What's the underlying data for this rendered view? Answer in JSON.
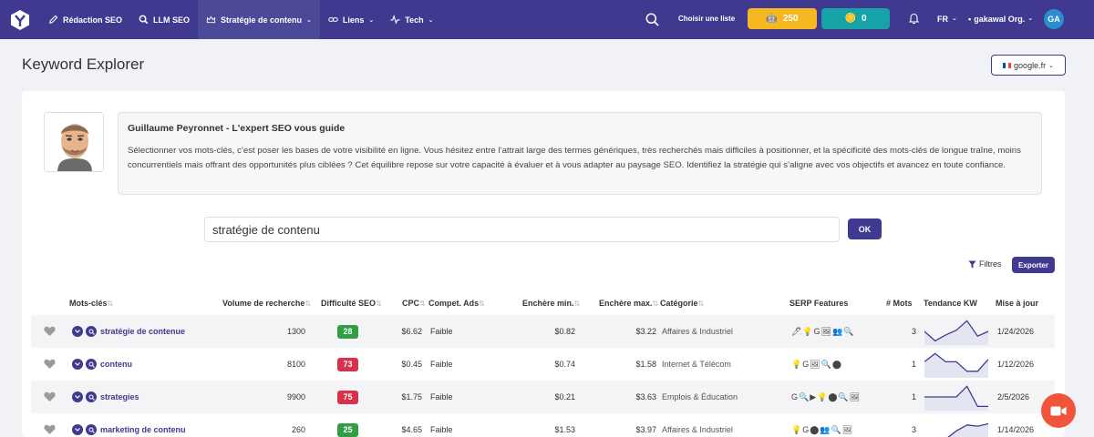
{
  "nav": {
    "items": [
      {
        "label": "Rédaction SEO",
        "icon": "pencil-icon"
      },
      {
        "label": "LLM SEO",
        "icon": "search-icon"
      },
      {
        "label": "Stratégie de contenu",
        "icon": "crown-icon"
      },
      {
        "label": "Liens",
        "icon": "link-icon"
      },
      {
        "label": "Tech",
        "icon": "pulse-icon"
      }
    ],
    "choose_list": "Choisir une liste",
    "credits_yellow": "250",
    "credits_teal": "0",
    "lang": "FR",
    "org": "gakawal Org.",
    "avatar": "GA"
  },
  "header": {
    "title": "Keyword Explorer",
    "engine": "google.fr"
  },
  "guide": {
    "title": "Guillaume Peyronnet - L'expert SEO vous guide",
    "text": "Sélectionner vos mots-clés, c’est poser les bases de votre visibilité en ligne. Vous hésitez entre l’attrait large des termes génériques, très recherchés mais difficiles à positionner, et la spécificité des mots-clés de longue traîne, moins concurrentiels mais offrant des opportunités plus ciblées ? Cet équilibre repose sur votre capacité à évaluer et à vous adapter au paysage SEO. Identifiez la stratégie qui s’aligne avec vos objectifs et avancez en toute confiance."
  },
  "search": {
    "value": "stratégie de contenu",
    "ok": "OK",
    "filters": "Filtres",
    "export": "Exporter"
  },
  "table": {
    "headers": {
      "kw": "Mots-clés",
      "vol": "Volume de recherche",
      "diff": "Difficulté SEO",
      "cpc": "CPC",
      "comp": "Compet. Ads",
      "bidmin": "Enchère min.",
      "bidmax": "Enchère max.",
      "cat": "Catégorie",
      "serp": "SERP Features",
      "words": "# Mots",
      "trend": "Tendance KW",
      "date": "Mise à jour"
    },
    "rows": [
      {
        "kw": "stratégie de contenue",
        "vol": "1300",
        "diff": "28",
        "diff_color": "#2f9e44",
        "cpc": "$6.62",
        "comp": "Faible",
        "bidmin": "$0.82",
        "bidmax": "$3.22",
        "cat": "Affaires & Industriel",
        "serp": "🖊💡G🖼👥🔍",
        "words": "3",
        "trend": [
          0.5,
          0.1,
          0.35,
          0.55,
          0.95,
          0.3,
          0.5
        ],
        "date": "1/24/2026"
      },
      {
        "kw": "contenu",
        "vol": "8100",
        "diff": "73",
        "diff_color": "#d6334a",
        "cpc": "$0.45",
        "comp": "Faible",
        "bidmin": "$0.74",
        "bidmax": "$1.58",
        "cat": "Internet & Télécom",
        "serp": "💡G🖼🔍⬤",
        "words": "1",
        "trend": [
          0.6,
          0.95,
          0.6,
          0.6,
          0.2,
          0.2,
          0.7
        ],
        "date": "1/12/2026"
      },
      {
        "kw": "strategies",
        "vol": "9900",
        "diff": "75",
        "diff_color": "#d6334a",
        "cpc": "$1.75",
        "comp": "Faible",
        "bidmin": "$0.21",
        "bidmax": "$3.63",
        "cat": "Emplois & Éducation",
        "serp": "G🔍▶💡⬤🔍🖼",
        "words": "1",
        "trend": [
          0.5,
          0.5,
          0.5,
          0.5,
          0.95,
          0.1,
          0.1
        ],
        "date": "2/5/2026"
      },
      {
        "kw": "marketing de contenu",
        "vol": "260",
        "diff": "25",
        "diff_color": "#2f9e44",
        "cpc": "$4.65",
        "comp": "Faible",
        "bidmin": "$1.53",
        "bidmax": "$3.97",
        "cat": "Affaires & Industriel",
        "serp": "💡G⬤👥🔍🖼",
        "words": "3",
        "trend": [
          0.1,
          0.05,
          0.1,
          0.45,
          0.7,
          0.65,
          0.75
        ],
        "date": "1/14/2026"
      }
    ]
  },
  "colors": {
    "brand": "#3f3a8f",
    "yellow": "#f5b820",
    "teal": "#17a2a7"
  }
}
